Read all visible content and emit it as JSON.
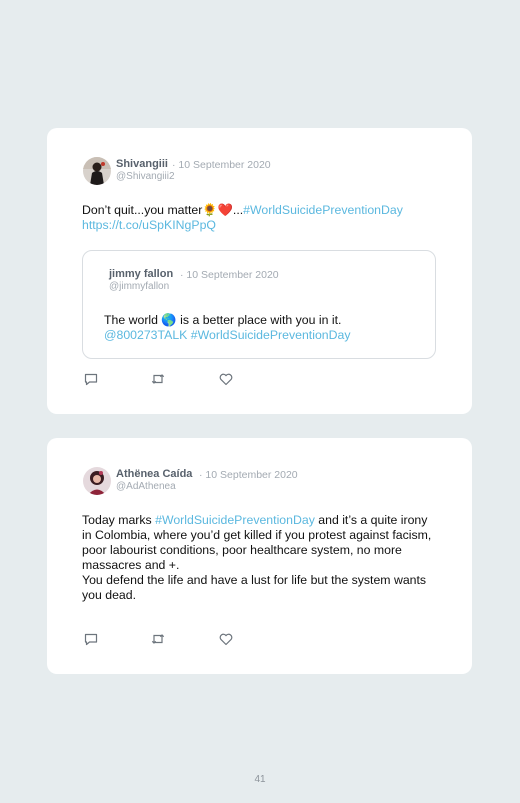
{
  "tweets": [
    {
      "name": "Shivangiii",
      "date": "· 10 September 2020",
      "handle": "@Shivangiii2",
      "text_before": "Don’t quit...you matter",
      "text_emoji": "🌻❤️",
      "text_dots": "...",
      "hashtag": "#WorldSuicidePreventionDay",
      "url": "https://t.co/uSpKINgPpQ",
      "quoted": {
        "name": "jimmy fallon",
        "date": "· 10 September 2020",
        "handle": "@jimmyfallon",
        "text_before": "The world ",
        "text_emoji": "🌎",
        "text_after": " is a better place with you in it.",
        "mention": "@800273TALK",
        "hashtag": "#WorldSuicidePreventionDay"
      }
    },
    {
      "name": "Athënea Caída",
      "date": "· 10 September 2020",
      "handle": "@AdAthenea",
      "text_before": "Today marks ",
      "hashtag": "#WorldSuicidePreventionDay",
      "text_after": " and it’s a quite irony in Colombia, where you’d get killed if you protest against facism, poor labourist conditions, poor healthcare system, no more massacres and +.",
      "text_second": "You defend the life and have a lust for life but the system wants you dead."
    }
  ],
  "actions": {
    "reply": "reply-icon",
    "retweet": "retweet-icon",
    "like": "heart-icon"
  },
  "page_number": "41",
  "colors": {
    "background": "#e6ecee",
    "card": "#ffffff",
    "link": "#5bb8df",
    "meta": "#a3aab2"
  }
}
